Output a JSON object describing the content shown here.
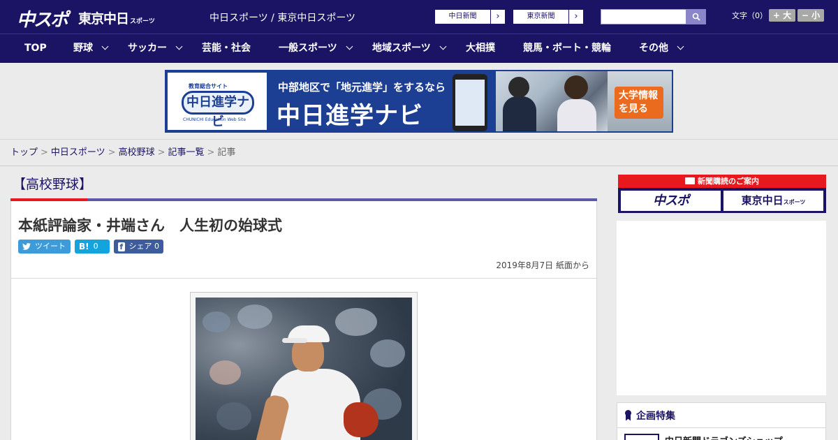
{
  "header": {
    "logo_chuspo": "中スポ",
    "logo_tokyo": "東京中日",
    "logo_tokyo_small": "スポーツ",
    "site_title": "中日スポーツ / 東京中日スポーツ",
    "paper_links": [
      {
        "label": "中日新聞",
        "arrow": "›"
      },
      {
        "label": "東京新聞",
        "arrow": "›"
      }
    ],
    "search": {
      "value": "",
      "icon": "search-icon"
    },
    "font_size_label": "文字（0）",
    "font_larger": "+ 大",
    "font_smaller": "− 小"
  },
  "nav": {
    "items": [
      {
        "label": "TOP",
        "has_menu": false
      },
      {
        "label": "野球",
        "has_menu": true
      },
      {
        "label": "サッカー",
        "has_menu": true
      },
      {
        "label": "芸能・社会",
        "has_menu": false
      },
      {
        "label": "一般スポーツ",
        "has_menu": true
      },
      {
        "label": "地域スポーツ",
        "has_menu": true
      },
      {
        "label": "大相撲",
        "has_menu": false
      },
      {
        "label": "競馬・ボート・競輪",
        "has_menu": false
      },
      {
        "label": "その他",
        "has_menu": true
      }
    ]
  },
  "banner": {
    "logo_sub": "教育総合サイト",
    "logo_main": "中日進学ナビ",
    "logo_en": "CHUNICHI Education Web Site",
    "headline": "中部地区で「地元進学」をするなら",
    "title": "中日進学ナビ",
    "cta": "大学情報を見る"
  },
  "breadcrumb": {
    "items": [
      "トップ",
      "中日スポーツ",
      "高校野球",
      "記事一覧"
    ],
    "current": "記事",
    "separator": ">"
  },
  "article": {
    "category": "【高校野球】",
    "title": "本紙評論家・井端さん　人生初の始球式",
    "share": {
      "tweet_label": "ツイート",
      "hatena_icon": "B!",
      "hatena_count": "0",
      "fb_icon": "f",
      "share_label": "シェア",
      "share_count": "0"
    },
    "date": "2019年8月7日 紙面から"
  },
  "sidebar": {
    "subscribe_title": "新聞購読のご案内",
    "subscribe_logo_1": "中スポ",
    "subscribe_logo_2": "東京中日",
    "subscribe_logo_2_small": "スポーツ",
    "feature_title": "企画特集",
    "feature_item": "中日新聞ドラゴンズショップ"
  },
  "colors": {
    "navy": "#1b1464",
    "red": "#e8191e",
    "twitter": "#3c9bd8",
    "hatena": "#13a3dd",
    "facebook": "#3e5b9c",
    "cta_orange": "#ea6a1e"
  }
}
